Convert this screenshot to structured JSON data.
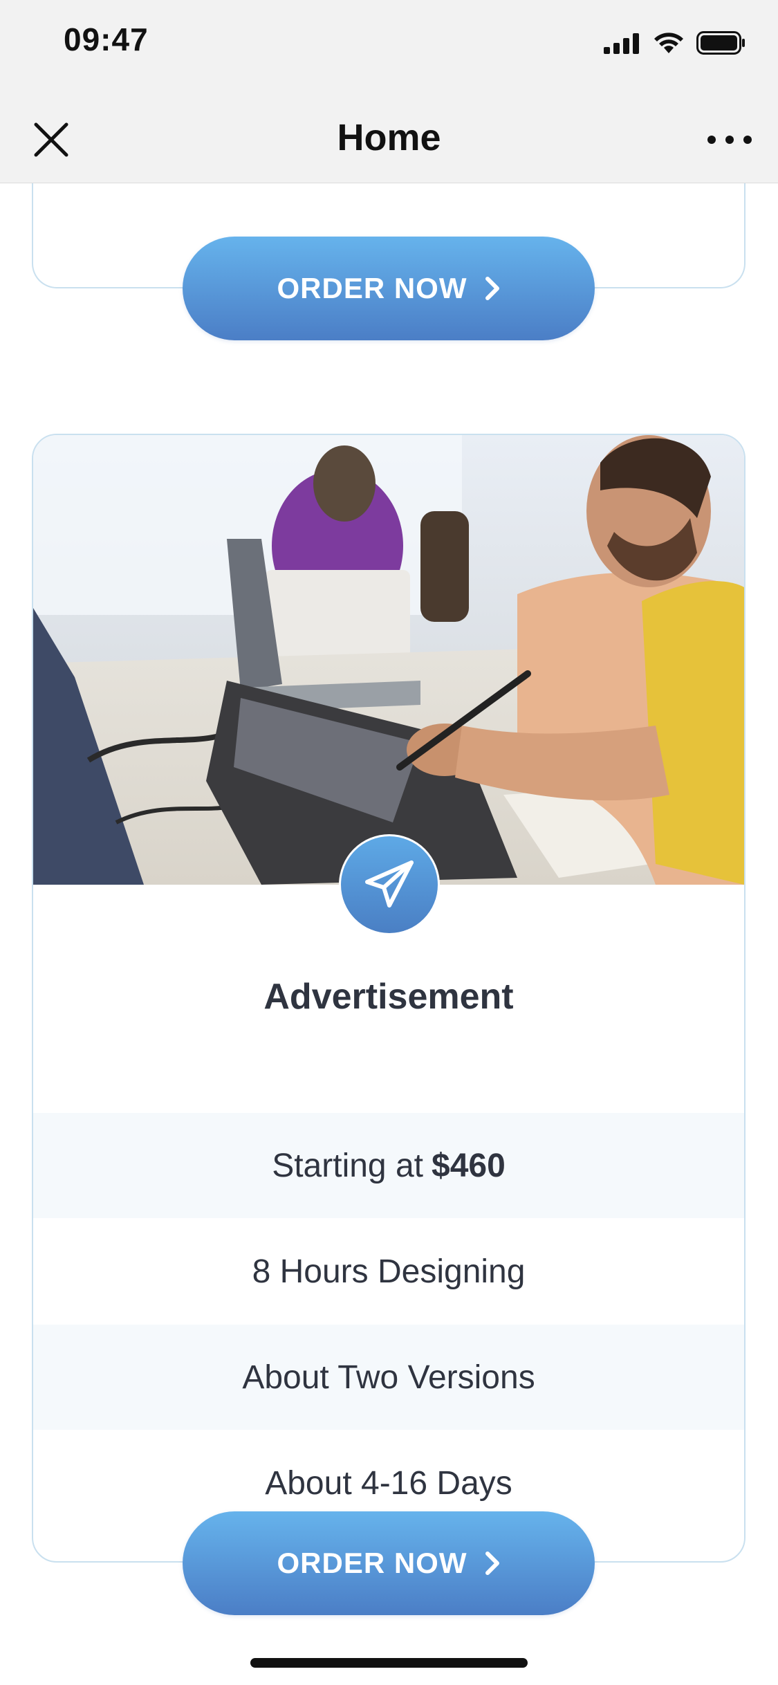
{
  "status_bar": {
    "time": "09:47",
    "icons": [
      "signal-icon",
      "wifi-icon",
      "battery-icon"
    ]
  },
  "nav": {
    "title": "Home",
    "close_icon": "close-icon",
    "more_icon": "more-icon"
  },
  "top_card": {
    "button_label": "ORDER NOW"
  },
  "advertisement_card": {
    "icon": "paper-plane-icon",
    "title": "Advertisement",
    "price_prefix": "Starting at",
    "price": "$460",
    "features": [
      "8 Hours Designing",
      "About Two Versions",
      "About 4-16 Days"
    ],
    "button_label": "ORDER NOW"
  },
  "colors": {
    "accent_top": "#66b3ec",
    "accent_bottom": "#4b7ec6",
    "card_border": "#c9e0ef",
    "row_shade": "#f5f9fc"
  }
}
